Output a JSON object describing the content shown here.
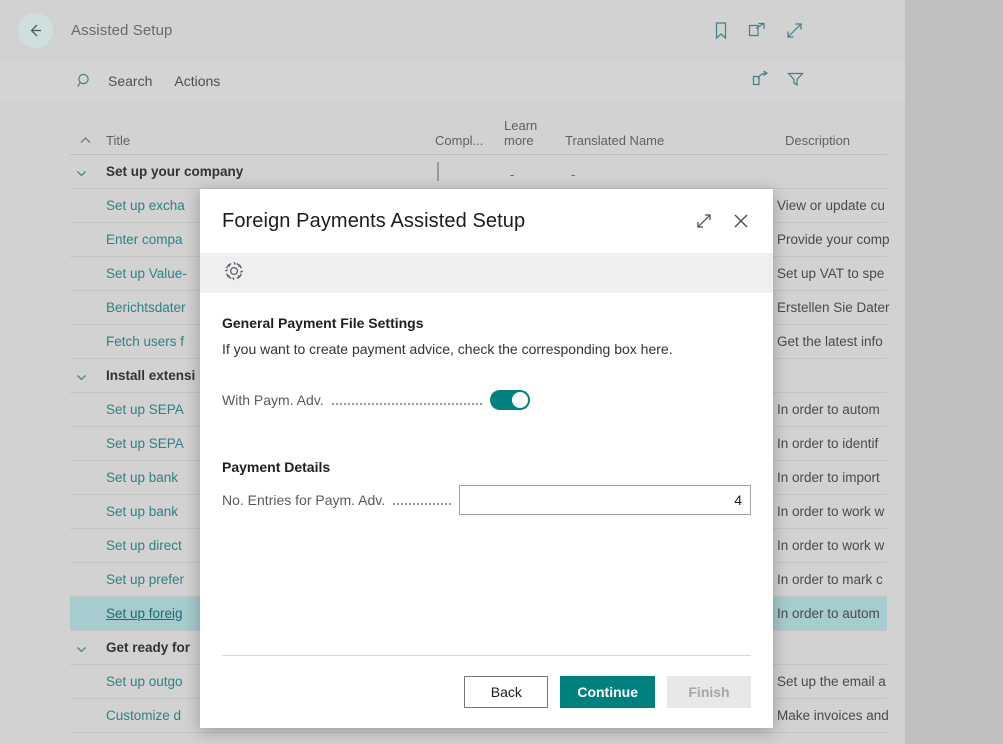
{
  "appbar": {
    "back_icon": "back-arrow-icon",
    "title": "Assisted Setup",
    "icons": [
      {
        "name": "bookmark-icon"
      },
      {
        "name": "open-in-new-window-icon"
      },
      {
        "name": "expand-diagonal-icon"
      }
    ]
  },
  "commandbar": {
    "search_icon": "search-icon",
    "search_label": "Search",
    "actions_label": "Actions",
    "right_icons": [
      {
        "name": "share-icon"
      },
      {
        "name": "filter-icon"
      }
    ]
  },
  "table": {
    "sort_icon": "sort-ascending-icon",
    "columns": [
      {
        "key": "title",
        "label": "Title"
      },
      {
        "key": "completed",
        "label": "Compl..."
      },
      {
        "key": "learn_more",
        "label_line1": "Learn",
        "label_line2": "more"
      },
      {
        "key": "translated_name",
        "label": "Translated Name"
      },
      {
        "key": "description",
        "label": "Description"
      }
    ],
    "rows": [
      {
        "type": "group",
        "title": "Set up your company",
        "checkbox": true,
        "learn_more": "-",
        "translated_name": "-",
        "description": ""
      },
      {
        "type": "item",
        "title": "Set up excha",
        "description": "View or update cu"
      },
      {
        "type": "item",
        "title": "Enter compa",
        "description": "Provide your comp"
      },
      {
        "type": "item",
        "title": "Set up Value-",
        "description": "Set up VAT to spe"
      },
      {
        "type": "item",
        "title": "Berichtsdater",
        "description": "Erstellen Sie Dater"
      },
      {
        "type": "item",
        "title": "Fetch users f",
        "description": "Get the latest info"
      },
      {
        "type": "group",
        "title": "Install extensi",
        "description": ""
      },
      {
        "type": "item",
        "title": "Set up SEPA",
        "description": "In order to autom"
      },
      {
        "type": "item",
        "title": "Set up SEPA",
        "description": "In order to identif"
      },
      {
        "type": "item",
        "title": "Set up bank",
        "description": "In order to import"
      },
      {
        "type": "item",
        "title": "Set up bank",
        "description": "In order to work w"
      },
      {
        "type": "item",
        "title": "Set up direct",
        "description": "In order to work w"
      },
      {
        "type": "item",
        "title": "Set up prefer",
        "description": "In order to mark c"
      },
      {
        "type": "item",
        "title": "Set up foreig",
        "description": "In order to autom",
        "selected": true
      },
      {
        "type": "group",
        "title": "Get ready for",
        "description": ""
      },
      {
        "type": "item",
        "title": "Set up outgo",
        "description": "Set up the email a"
      },
      {
        "type": "item",
        "title": "Customize d",
        "description": "Make invoices and"
      }
    ]
  },
  "dialog": {
    "title": "Foreign Payments Assisted Setup",
    "head_icons": [
      {
        "name": "expand-diagonal-icon"
      },
      {
        "name": "close-icon"
      }
    ],
    "banner_icon": "gear-icon",
    "section1": {
      "heading": "General Payment File Settings",
      "description": "If you want to create payment advice, check the corresponding box here.",
      "toggle_label": "With Paym. Adv.",
      "toggle_on": true
    },
    "section2": {
      "heading": "Payment Details",
      "field_label": "No. Entries for Paym. Adv.",
      "field_value": "4"
    },
    "buttons": {
      "back": "Back",
      "continue": "Continue",
      "finish": "Finish"
    }
  },
  "colors": {
    "accent_teal": "#00807f",
    "link_teal": "#2d8186",
    "selected_row": "#a6cccf",
    "page_bg": "#d2d2d2"
  }
}
